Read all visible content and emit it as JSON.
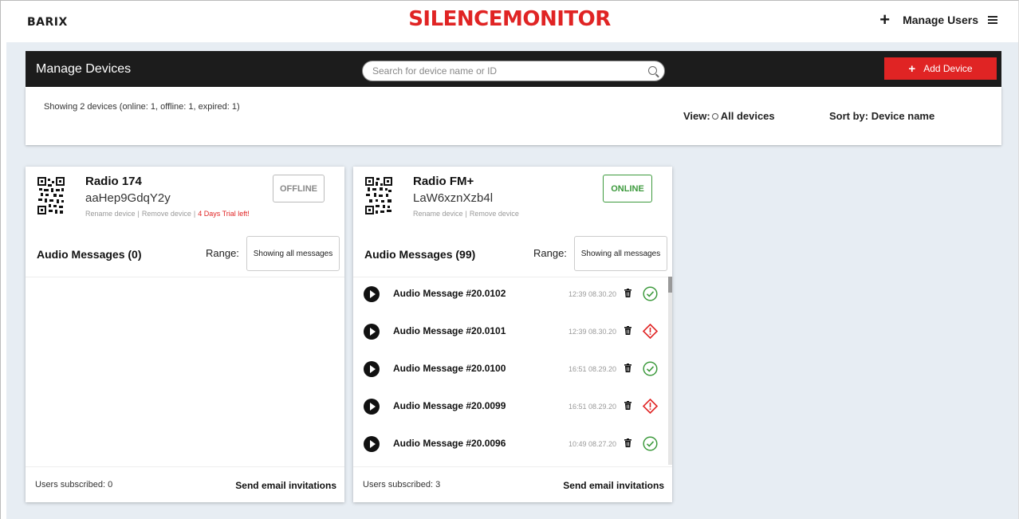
{
  "header": {
    "logo": "BARIX",
    "brand": "SILENCEMONITOR",
    "add_icon": "plus-icon",
    "manage_users_label": "Manage Users",
    "menu_icon": "hamburger-icon"
  },
  "devices_panel": {
    "title": "Manage Devices",
    "search_placeholder": "Search for device name or ID",
    "add_device_label": "Add Device",
    "summary": "Showing 2 devices (online: 1, offline: 1, expired: 1)",
    "view_label": "View:",
    "view_value": "All devices",
    "sort_label": "Sort by: Device name"
  },
  "colors": {
    "brand_red": "#e02424",
    "header_dark": "#1c1c1c",
    "background": "#e7edf3",
    "online_green": "#3d9a3d"
  },
  "devices": [
    {
      "name": "Radio 174",
      "id": "aaHep9GdqY2y",
      "rename": "Rename device",
      "remove": "Remove device",
      "trial": "4 Days Trial left!",
      "status": "OFFLINE",
      "messages_title": "Audio Messages (0)",
      "range_label": "Range:",
      "range_value": "Showing all messages",
      "users": "Users subscribed: 0",
      "send": "Send email invitations",
      "messages": []
    },
    {
      "name": "Radio FM+",
      "id": "LaW6xznXzb4l",
      "rename": "Rename device",
      "remove": "Remove device",
      "status": "ONLINE",
      "messages_title": "Audio Messages (99)",
      "range_label": "Range:",
      "range_value": "Showing all messages",
      "users": "Users subscribed: 3",
      "send": "Send email invitations",
      "messages": [
        {
          "title": "Audio Message #20.0102",
          "time": "12:39 08.30.20",
          "status": "ok"
        },
        {
          "title": "Audio Message #20.0101",
          "time": "12:39 08.30.20",
          "status": "warning"
        },
        {
          "title": "Audio Message #20.0100",
          "time": "16:51 08.29.20",
          "status": "ok"
        },
        {
          "title": "Audio Message #20.0099",
          "time": "16:51 08.29.20",
          "status": "warning"
        },
        {
          "title": "Audio Message #20.0096",
          "time": "10:49 08.27.20",
          "status": "ok"
        }
      ]
    }
  ]
}
